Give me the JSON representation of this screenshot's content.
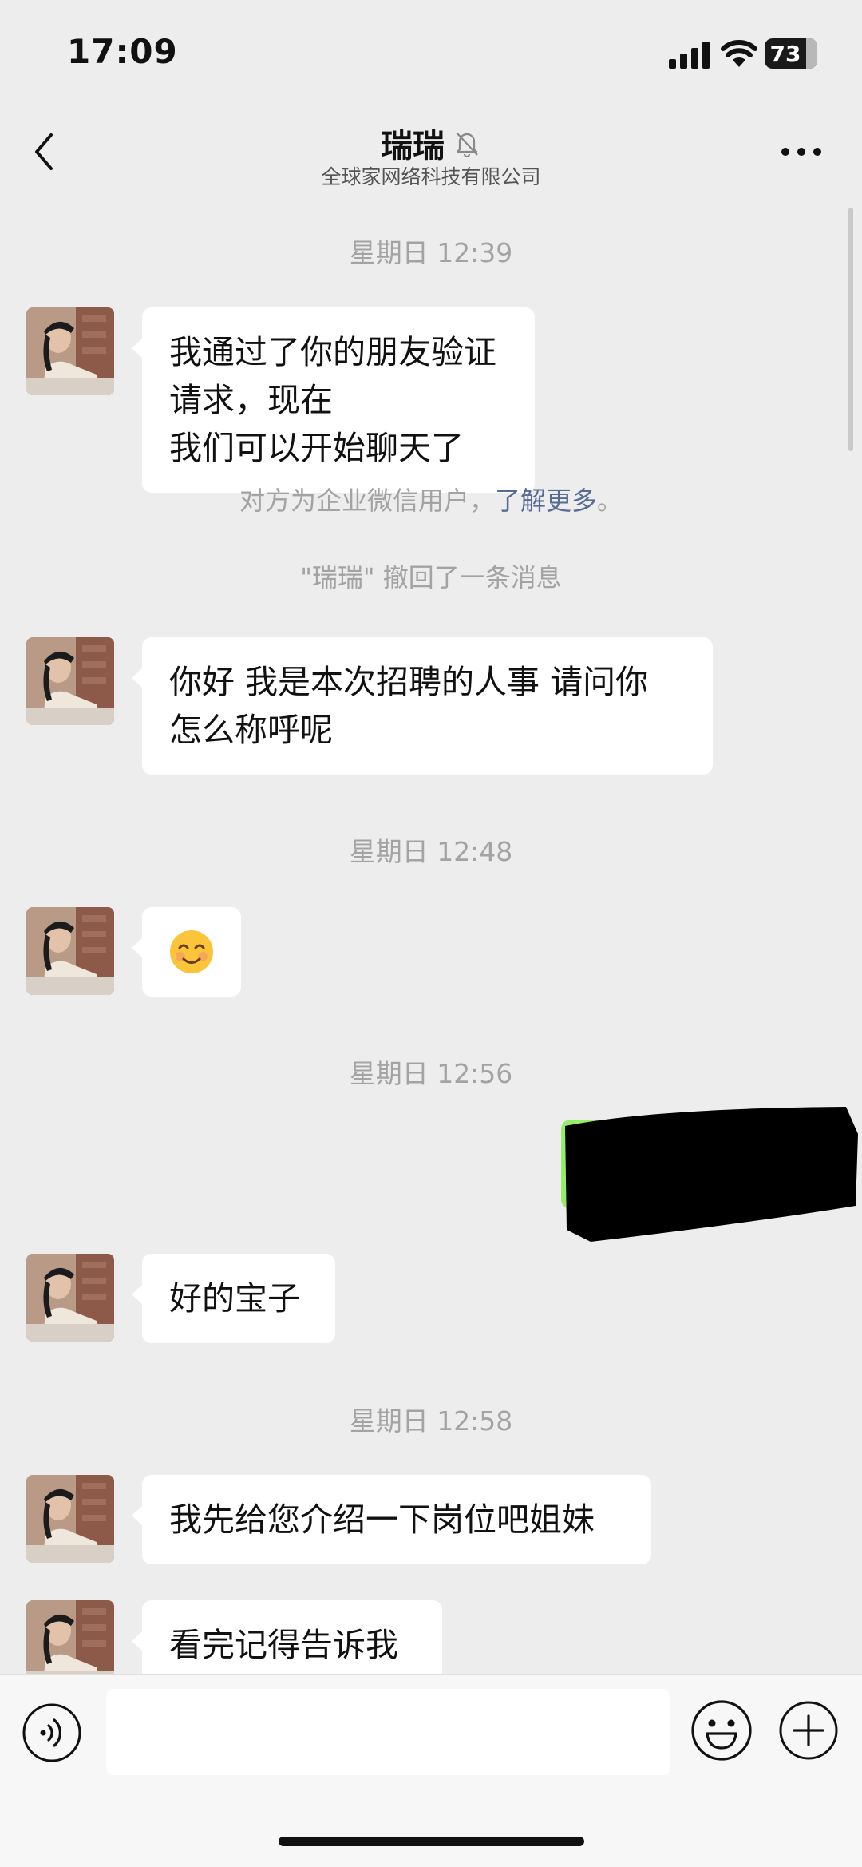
{
  "status_bar": {
    "time": "17:09",
    "battery": "73"
  },
  "header": {
    "title": "瑞瑞",
    "subtitle": "全球家网络科技有限公司",
    "back_icon": "chevron-left-icon",
    "mute_icon": "bell-slash-icon",
    "more_icon": "ellipsis-icon"
  },
  "messages": [
    {
      "type": "time",
      "text": "星期日 12:39"
    },
    {
      "type": "received",
      "lines": [
        "我通过了你的朋友验证请求，现在",
        "我们可以开始聊天了"
      ]
    },
    {
      "type": "system",
      "text": "对方为企业微信用户，",
      "link": "了解更多",
      "suffix": "。"
    },
    {
      "type": "system",
      "text": "\"瑞瑞\" 撤回了一条消息"
    },
    {
      "type": "received",
      "lines": [
        "你好  我是本次招聘的人事 请问你",
        "怎么称呼呢"
      ]
    },
    {
      "type": "time",
      "text": "星期日 12:48"
    },
    {
      "type": "received",
      "emoji": "smiling-face-icon"
    },
    {
      "type": "time",
      "text": "星期日 12:56"
    },
    {
      "type": "sent",
      "redacted": true
    },
    {
      "type": "received",
      "lines": [
        "好的宝子"
      ]
    },
    {
      "type": "time",
      "text": "星期日 12:58"
    },
    {
      "type": "received",
      "lines": [
        "我先给您介绍一下岗位吧姐妹"
      ]
    },
    {
      "type": "received",
      "lines": [
        "看完记得告诉我"
      ]
    }
  ],
  "input_bar": {
    "voice_icon": "voice-icon",
    "emoji_icon": "emoji-icon",
    "plus_icon": "plus-icon",
    "input_value": ""
  },
  "colors": {
    "background": "#ededed",
    "sent_bubble": "#95ec69",
    "link": "#576b95"
  }
}
